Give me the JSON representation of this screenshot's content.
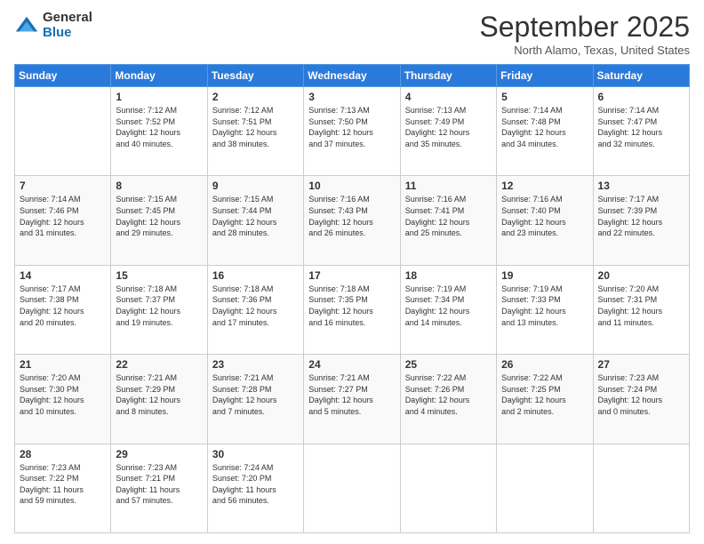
{
  "logo": {
    "general": "General",
    "blue": "Blue"
  },
  "header": {
    "month": "September 2025",
    "location": "North Alamo, Texas, United States"
  },
  "weekdays": [
    "Sunday",
    "Monday",
    "Tuesday",
    "Wednesday",
    "Thursday",
    "Friday",
    "Saturday"
  ],
  "weeks": [
    [
      {
        "day": "",
        "info": ""
      },
      {
        "day": "1",
        "info": "Sunrise: 7:12 AM\nSunset: 7:52 PM\nDaylight: 12 hours\nand 40 minutes."
      },
      {
        "day": "2",
        "info": "Sunrise: 7:12 AM\nSunset: 7:51 PM\nDaylight: 12 hours\nand 38 minutes."
      },
      {
        "day": "3",
        "info": "Sunrise: 7:13 AM\nSunset: 7:50 PM\nDaylight: 12 hours\nand 37 minutes."
      },
      {
        "day": "4",
        "info": "Sunrise: 7:13 AM\nSunset: 7:49 PM\nDaylight: 12 hours\nand 35 minutes."
      },
      {
        "day": "5",
        "info": "Sunrise: 7:14 AM\nSunset: 7:48 PM\nDaylight: 12 hours\nand 34 minutes."
      },
      {
        "day": "6",
        "info": "Sunrise: 7:14 AM\nSunset: 7:47 PM\nDaylight: 12 hours\nand 32 minutes."
      }
    ],
    [
      {
        "day": "7",
        "info": "Sunrise: 7:14 AM\nSunset: 7:46 PM\nDaylight: 12 hours\nand 31 minutes."
      },
      {
        "day": "8",
        "info": "Sunrise: 7:15 AM\nSunset: 7:45 PM\nDaylight: 12 hours\nand 29 minutes."
      },
      {
        "day": "9",
        "info": "Sunrise: 7:15 AM\nSunset: 7:44 PM\nDaylight: 12 hours\nand 28 minutes."
      },
      {
        "day": "10",
        "info": "Sunrise: 7:16 AM\nSunset: 7:43 PM\nDaylight: 12 hours\nand 26 minutes."
      },
      {
        "day": "11",
        "info": "Sunrise: 7:16 AM\nSunset: 7:41 PM\nDaylight: 12 hours\nand 25 minutes."
      },
      {
        "day": "12",
        "info": "Sunrise: 7:16 AM\nSunset: 7:40 PM\nDaylight: 12 hours\nand 23 minutes."
      },
      {
        "day": "13",
        "info": "Sunrise: 7:17 AM\nSunset: 7:39 PM\nDaylight: 12 hours\nand 22 minutes."
      }
    ],
    [
      {
        "day": "14",
        "info": "Sunrise: 7:17 AM\nSunset: 7:38 PM\nDaylight: 12 hours\nand 20 minutes."
      },
      {
        "day": "15",
        "info": "Sunrise: 7:18 AM\nSunset: 7:37 PM\nDaylight: 12 hours\nand 19 minutes."
      },
      {
        "day": "16",
        "info": "Sunrise: 7:18 AM\nSunset: 7:36 PM\nDaylight: 12 hours\nand 17 minutes."
      },
      {
        "day": "17",
        "info": "Sunrise: 7:18 AM\nSunset: 7:35 PM\nDaylight: 12 hours\nand 16 minutes."
      },
      {
        "day": "18",
        "info": "Sunrise: 7:19 AM\nSunset: 7:34 PM\nDaylight: 12 hours\nand 14 minutes."
      },
      {
        "day": "19",
        "info": "Sunrise: 7:19 AM\nSunset: 7:33 PM\nDaylight: 12 hours\nand 13 minutes."
      },
      {
        "day": "20",
        "info": "Sunrise: 7:20 AM\nSunset: 7:31 PM\nDaylight: 12 hours\nand 11 minutes."
      }
    ],
    [
      {
        "day": "21",
        "info": "Sunrise: 7:20 AM\nSunset: 7:30 PM\nDaylight: 12 hours\nand 10 minutes."
      },
      {
        "day": "22",
        "info": "Sunrise: 7:21 AM\nSunset: 7:29 PM\nDaylight: 12 hours\nand 8 minutes."
      },
      {
        "day": "23",
        "info": "Sunrise: 7:21 AM\nSunset: 7:28 PM\nDaylight: 12 hours\nand 7 minutes."
      },
      {
        "day": "24",
        "info": "Sunrise: 7:21 AM\nSunset: 7:27 PM\nDaylight: 12 hours\nand 5 minutes."
      },
      {
        "day": "25",
        "info": "Sunrise: 7:22 AM\nSunset: 7:26 PM\nDaylight: 12 hours\nand 4 minutes."
      },
      {
        "day": "26",
        "info": "Sunrise: 7:22 AM\nSunset: 7:25 PM\nDaylight: 12 hours\nand 2 minutes."
      },
      {
        "day": "27",
        "info": "Sunrise: 7:23 AM\nSunset: 7:24 PM\nDaylight: 12 hours\nand 0 minutes."
      }
    ],
    [
      {
        "day": "28",
        "info": "Sunrise: 7:23 AM\nSunset: 7:22 PM\nDaylight: 11 hours\nand 59 minutes."
      },
      {
        "day": "29",
        "info": "Sunrise: 7:23 AM\nSunset: 7:21 PM\nDaylight: 11 hours\nand 57 minutes."
      },
      {
        "day": "30",
        "info": "Sunrise: 7:24 AM\nSunset: 7:20 PM\nDaylight: 11 hours\nand 56 minutes."
      },
      {
        "day": "",
        "info": ""
      },
      {
        "day": "",
        "info": ""
      },
      {
        "day": "",
        "info": ""
      },
      {
        "day": "",
        "info": ""
      }
    ]
  ]
}
